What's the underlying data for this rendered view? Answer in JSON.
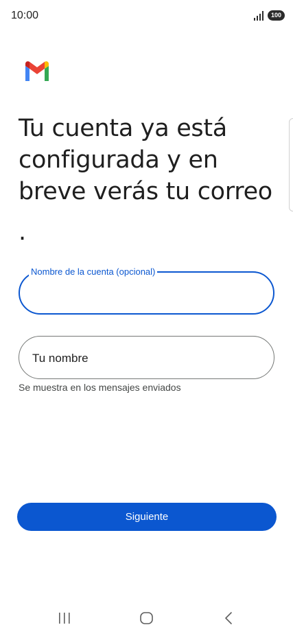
{
  "status_bar": {
    "time": "10:00",
    "battery": "100",
    "icons": [
      "signal-icon",
      "battery-icon"
    ]
  },
  "app": {
    "logo": "gmail-logo",
    "colors": {
      "primary": "#0b57d0",
      "text": "#1f1f1f",
      "helper": "#444746"
    }
  },
  "main": {
    "headline": "Tu cuenta ya está configurada y en breve verás tu correo",
    "headline_dot": ".",
    "account_field": {
      "label": "Nombre de la cuenta (opcional)",
      "value": ""
    },
    "name_field": {
      "placeholder": "Tu nombre",
      "helper": "Se muestra en los mensajes enviados"
    },
    "next_button_label": "Siguiente"
  },
  "nav_bar": {
    "icons": [
      "recents-icon",
      "home-icon",
      "back-icon"
    ]
  }
}
